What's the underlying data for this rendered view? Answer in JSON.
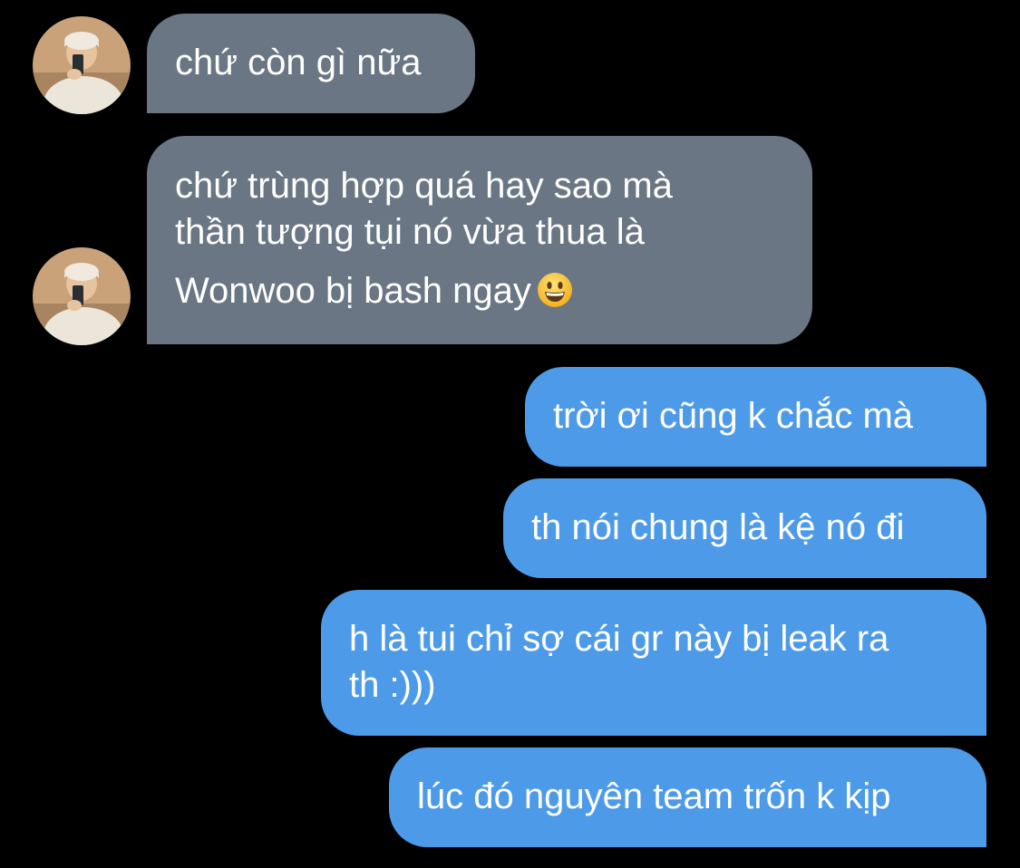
{
  "conversation": {
    "messages": [
      {
        "direction": "incoming",
        "lines": [
          "chứ còn gì nữa"
        ]
      },
      {
        "direction": "incoming",
        "lines": [
          "chứ trùng hợp quá hay sao mà",
          "thần tượng tụi nó vừa thua là",
          "Wonwoo bị bash ngay"
        ],
        "emoji": "grinning-face-emoji"
      },
      {
        "direction": "outgoing",
        "lines": [
          "trời ơi cũng k chắc mà"
        ]
      },
      {
        "direction": "outgoing",
        "lines": [
          "th nói chung là kệ nó đi"
        ]
      },
      {
        "direction": "outgoing",
        "lines": [
          "h là tui chỉ sợ cái gr này bị leak ra",
          "th :)))"
        ]
      },
      {
        "direction": "outgoing",
        "lines": [
          "lúc đó nguyên team trốn k kịp"
        ]
      }
    ]
  },
  "colors": {
    "background": "#000000",
    "incoming_bubble": "#6a7683",
    "outgoing_bubble": "#4d9be8",
    "text": "#ffffff"
  }
}
